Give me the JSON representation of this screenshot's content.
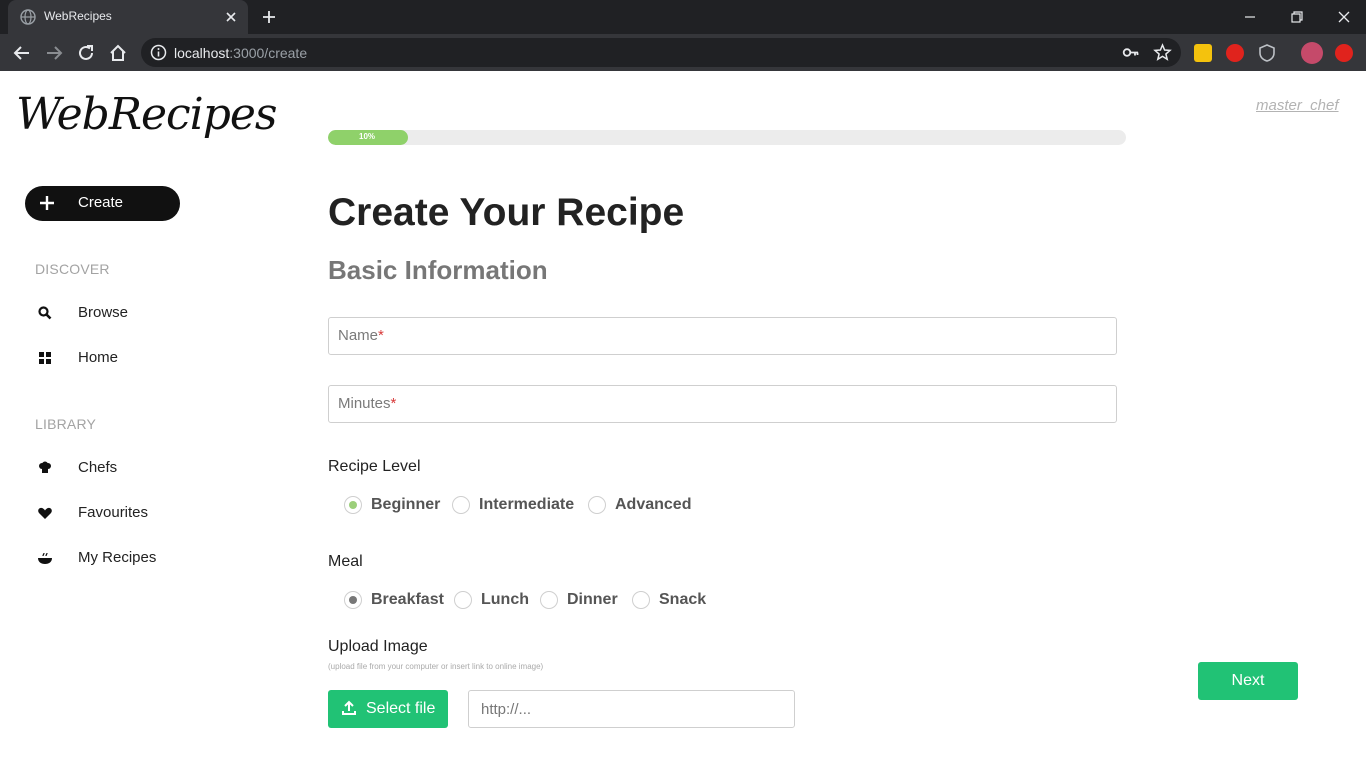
{
  "browser": {
    "tab_title": "WebRecipes",
    "url_host": "localhost",
    "url_path": ":3000/create"
  },
  "app": {
    "logo_text": "WebRecipes",
    "user": "master_chef",
    "create_label": "Create",
    "progress_label": "10%",
    "progress_value": 0.1,
    "accent_color": "#21c275",
    "progress_color": "#8fd16a"
  },
  "sidebar": {
    "discover_heading": "DISCOVER",
    "library_heading": "LIBRARY",
    "items": [
      {
        "label": "Browse",
        "icon": "search-icon"
      },
      {
        "label": "Home",
        "icon": "grid-icon"
      },
      {
        "label": "Chefs",
        "icon": "chef-hat-icon"
      },
      {
        "label": "Favourites",
        "icon": "heart-icon"
      },
      {
        "label": "My Recipes",
        "icon": "bowl-icon"
      }
    ]
  },
  "form": {
    "title": "Create Your Recipe",
    "subtitle": "Basic Information",
    "name_placeholder": "Name",
    "minutes_placeholder": "Minutes",
    "required_mark": "*",
    "level_label": "Recipe Level",
    "levels": [
      "Beginner",
      "Intermediate",
      "Advanced"
    ],
    "selected_level": "Beginner",
    "meal_label": "Meal",
    "meals": [
      "Breakfast",
      "Lunch",
      "Dinner",
      "Snack"
    ],
    "selected_meal": "Breakfast",
    "upload_label": "Upload Image",
    "upload_note": "(upload file from your computer or insert link to online image)",
    "select_file_label": "Select file",
    "url_placeholder": "http://...",
    "next_label": "Next"
  }
}
